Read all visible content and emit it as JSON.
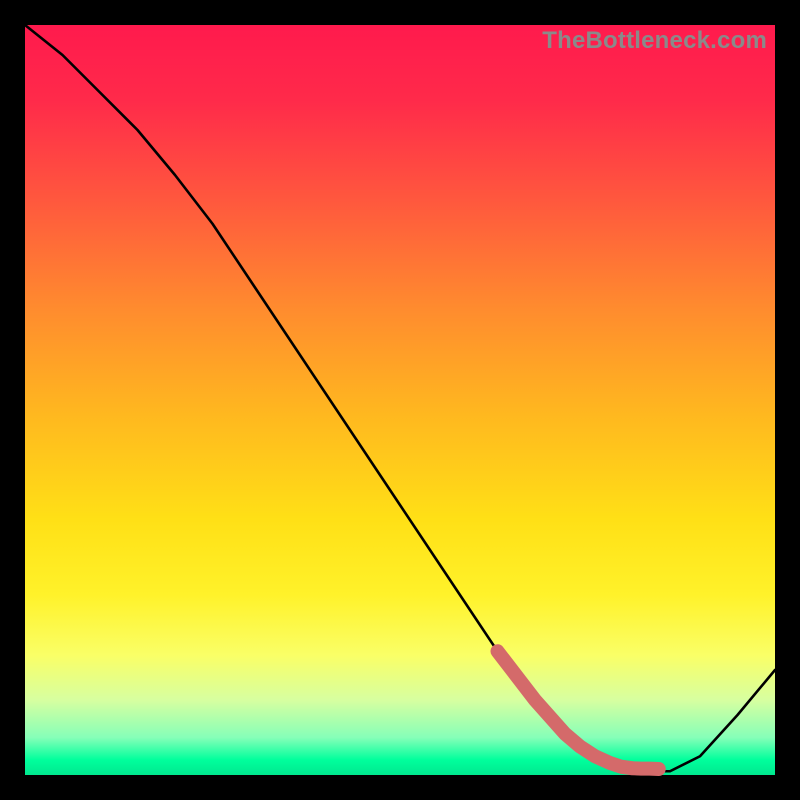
{
  "watermark": "TheBottleneck.com",
  "chart_data": {
    "type": "line",
    "title": "",
    "xlabel": "",
    "ylabel": "",
    "xlim": [
      0,
      100
    ],
    "ylim": [
      0,
      100
    ],
    "series": [
      {
        "name": "main-curve",
        "color": "#000000",
        "x": [
          0,
          5,
          10,
          15,
          20,
          25,
          30,
          35,
          40,
          45,
          50,
          55,
          60,
          65,
          70,
          75,
          80,
          83,
          86,
          90,
          95,
          100
        ],
        "y": [
          100,
          96,
          91,
          86,
          80,
          73.5,
          66,
          58.5,
          51,
          43.5,
          36,
          28.5,
          21,
          13.5,
          7,
          3,
          1,
          0.5,
          0.5,
          2.5,
          8,
          14
        ]
      },
      {
        "name": "highlight-segment",
        "color": "#d46a6a",
        "x": [
          63,
          68,
          72,
          74,
          76,
          78,
          79.5,
          81,
          82.2,
          83.3,
          84.5
        ],
        "y": [
          16.5,
          10,
          5.5,
          3.8,
          2.5,
          1.6,
          1.1,
          0.9,
          0.85,
          0.85,
          0.8
        ]
      }
    ],
    "highlight_dots": [
      {
        "x": 79.5,
        "y": 1.1,
        "r": 6
      },
      {
        "x": 81.0,
        "y": 0.9,
        "r": 6
      },
      {
        "x": 82.2,
        "y": 0.85,
        "r": 6
      },
      {
        "x": 83.3,
        "y": 0.85,
        "r": 5
      },
      {
        "x": 84.5,
        "y": 0.8,
        "r": 6
      }
    ]
  }
}
